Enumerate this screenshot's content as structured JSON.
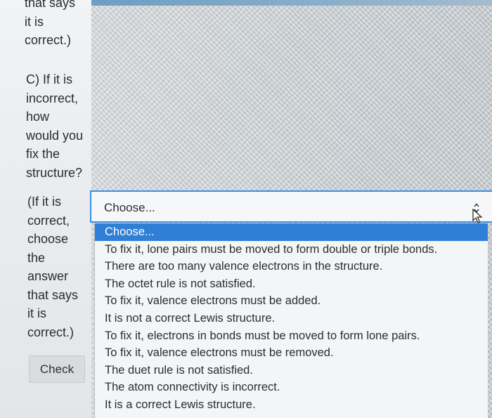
{
  "question_text": {
    "tail_b": "that says\nit is\ncorrect.)",
    "part_c": "C) If it is\nincorrect,\nhow\nwould you\nfix the\nstructure?",
    "hint": "(If it is\ncorrect,\nchoose\nthe\nanswer\nthat says\nit is\ncorrect.)"
  },
  "check_button": {
    "label": "Check"
  },
  "select": {
    "current_value": "Choose...",
    "options": [
      {
        "label": "Choose...",
        "selected": true
      },
      {
        "label": "To fix it, lone pairs must be moved to form double or triple bonds.",
        "selected": false
      },
      {
        "label": "There are too many valence electrons in the structure.",
        "selected": false
      },
      {
        "label": "The octet rule is not satisfied.",
        "selected": false
      },
      {
        "label": "To fix it, valence electrons must be added.",
        "selected": false
      },
      {
        "label": "It is not a correct Lewis structure.",
        "selected": false
      },
      {
        "label": "To fix it, electrons in bonds must be moved to form lone pairs.",
        "selected": false
      },
      {
        "label": "To fix it, valence electrons must be removed.",
        "selected": false
      },
      {
        "label": "The duet rule is not satisfied.",
        "selected": false
      },
      {
        "label": "The atom connectivity is incorrect.",
        "selected": false
      },
      {
        "label": "It is a correct Lewis structure.",
        "selected": false
      }
    ]
  },
  "icons": {
    "select_arrow": "up-down-chevron-icon",
    "pointer": "mouse-pointer-icon"
  },
  "colors": {
    "select_border": "#3a8ee6",
    "highlight": "#2f7fd6",
    "highlight_text": "#ffffff"
  }
}
